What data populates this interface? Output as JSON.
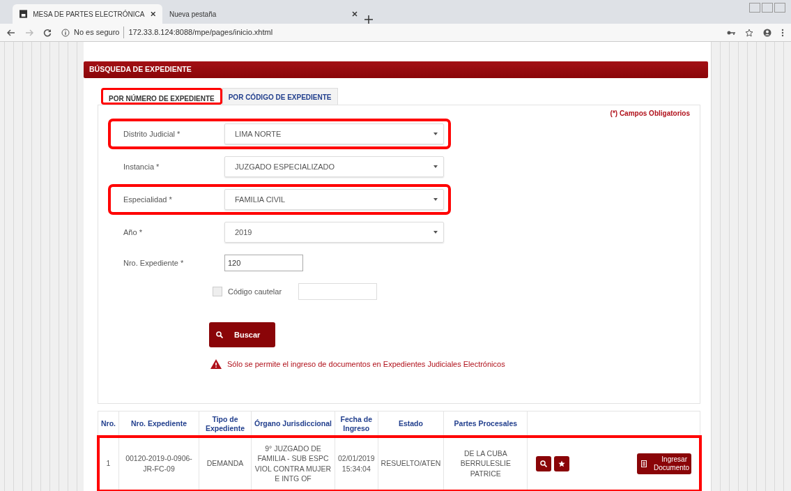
{
  "browser": {
    "tabs": [
      {
        "title": "MESA DE PARTES ELECTRÓNICA",
        "selected": true
      },
      {
        "title": "Nueva pestaña",
        "selected": false
      }
    ],
    "security": "No es seguro",
    "url": "172.33.8.124:8088/mpe/pages/inicio.xhtml"
  },
  "panel": {
    "title": "BÚSQUEDA DE EXPEDIENTE",
    "tabs": [
      {
        "label": "POR NÚMERO DE EXPEDIENTE",
        "selected": true,
        "highlighted": true
      },
      {
        "label": "POR CÓDIGO DE EXPEDIENTE",
        "selected": false,
        "highlighted": false
      }
    ],
    "required_note": "(*) Campos Obligatorios",
    "fields": [
      {
        "kind": "select",
        "label": "Distrito Judicial *",
        "value": "LIMA NORTE",
        "highlighted": true
      },
      {
        "kind": "select",
        "label": "Instancia *",
        "value": "JUZGADO ESPECIALIZADO",
        "highlighted": false
      },
      {
        "kind": "select",
        "label": "Especialidad *",
        "value": "FAMILIA CIVIL",
        "highlighted": true
      },
      {
        "kind": "select",
        "label": "Año *",
        "value": "2019",
        "highlighted": false
      },
      {
        "kind": "text",
        "label": "Nro. Expediente *",
        "value": "120",
        "highlighted": false
      }
    ],
    "cautelar": {
      "label": "Código cautelar",
      "checked": false
    },
    "search_button": "Buscar",
    "warning": "Sólo se permite el ingreso de documentos en Expedientes Judiciales Electrónicos"
  },
  "table": {
    "columns": [
      "Nro.",
      "Nro. Expediente",
      "Tipo de Expediente",
      "Órgano Jurisdiccional",
      "Fecha de Ingreso",
      "Estado",
      "Partes Procesales"
    ],
    "rows": [
      {
        "highlighted": true,
        "cells": [
          "1",
          "00120-2019-0-0906-JR-FC-09",
          "DEMANDA",
          "9° JUZGADO DE FAMILIA - SUB ESPC VIOL CONTRA MUJER E INTG OF",
          "02/01/2019 15:34:04",
          "RESUELTO/ATEN",
          "DE LA CUBA BERRULESLIE PATRICE"
        ],
        "action_button": "Ingresar Documento"
      }
    ]
  }
}
